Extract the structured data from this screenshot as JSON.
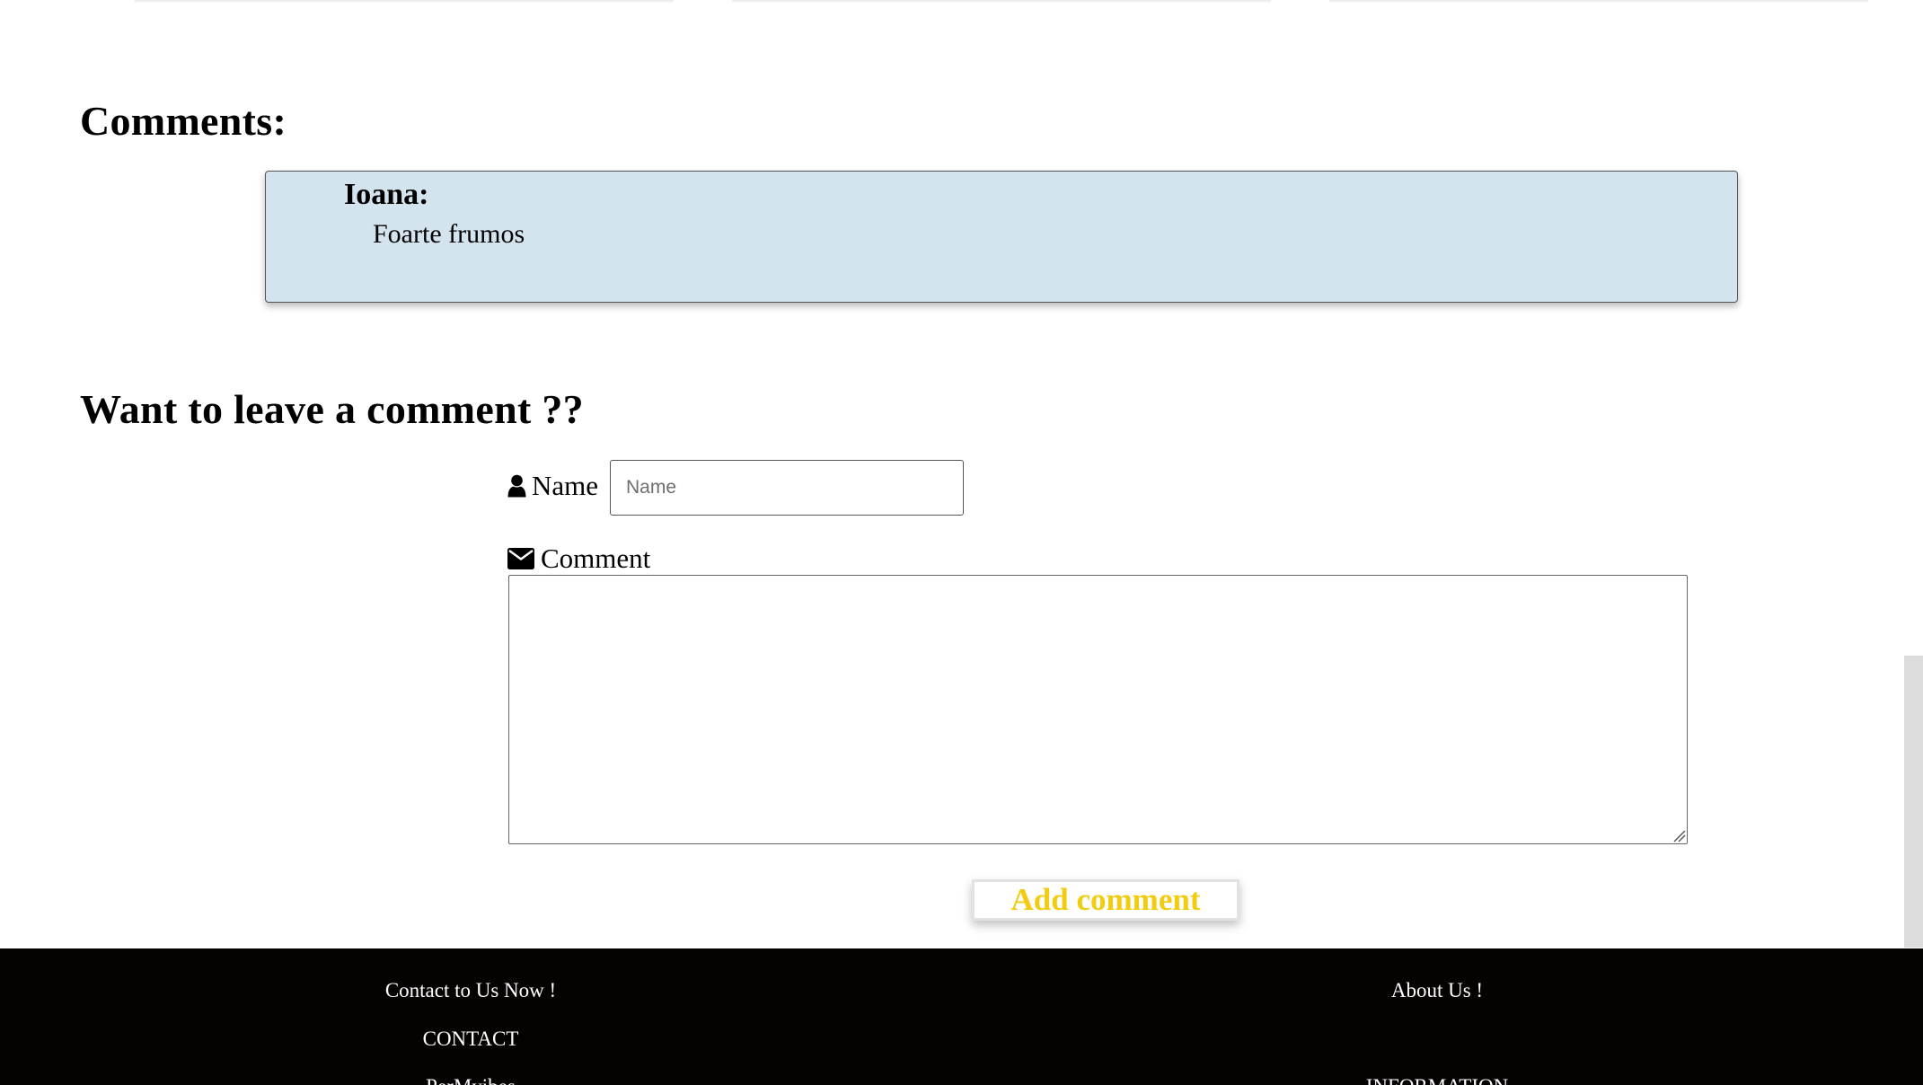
{
  "comments_section": {
    "title": "Comments:",
    "items": [
      {
        "author": "Ioana:",
        "text": "Foarte frumos"
      }
    ]
  },
  "comment_form": {
    "title": "Want to leave a comment ??",
    "name_label": "Name",
    "name_icon": "user-icon",
    "name_value": "",
    "name_placeholder": "Name",
    "comment_label": "Comment",
    "comment_icon": "envelope-icon",
    "comment_value": "",
    "submit_label": "Add comment"
  },
  "footer": {
    "left": {
      "heading": "Contact to Us Now !",
      "link": "CONTACT",
      "partial_text": "PerMyibes"
    },
    "right": {
      "heading": "About Us !",
      "link": "INFORMATION"
    }
  },
  "colors": {
    "comment_card_bg": "#d4e4ee",
    "button_text": "#f3cc10",
    "footer_bg": "#060202"
  }
}
